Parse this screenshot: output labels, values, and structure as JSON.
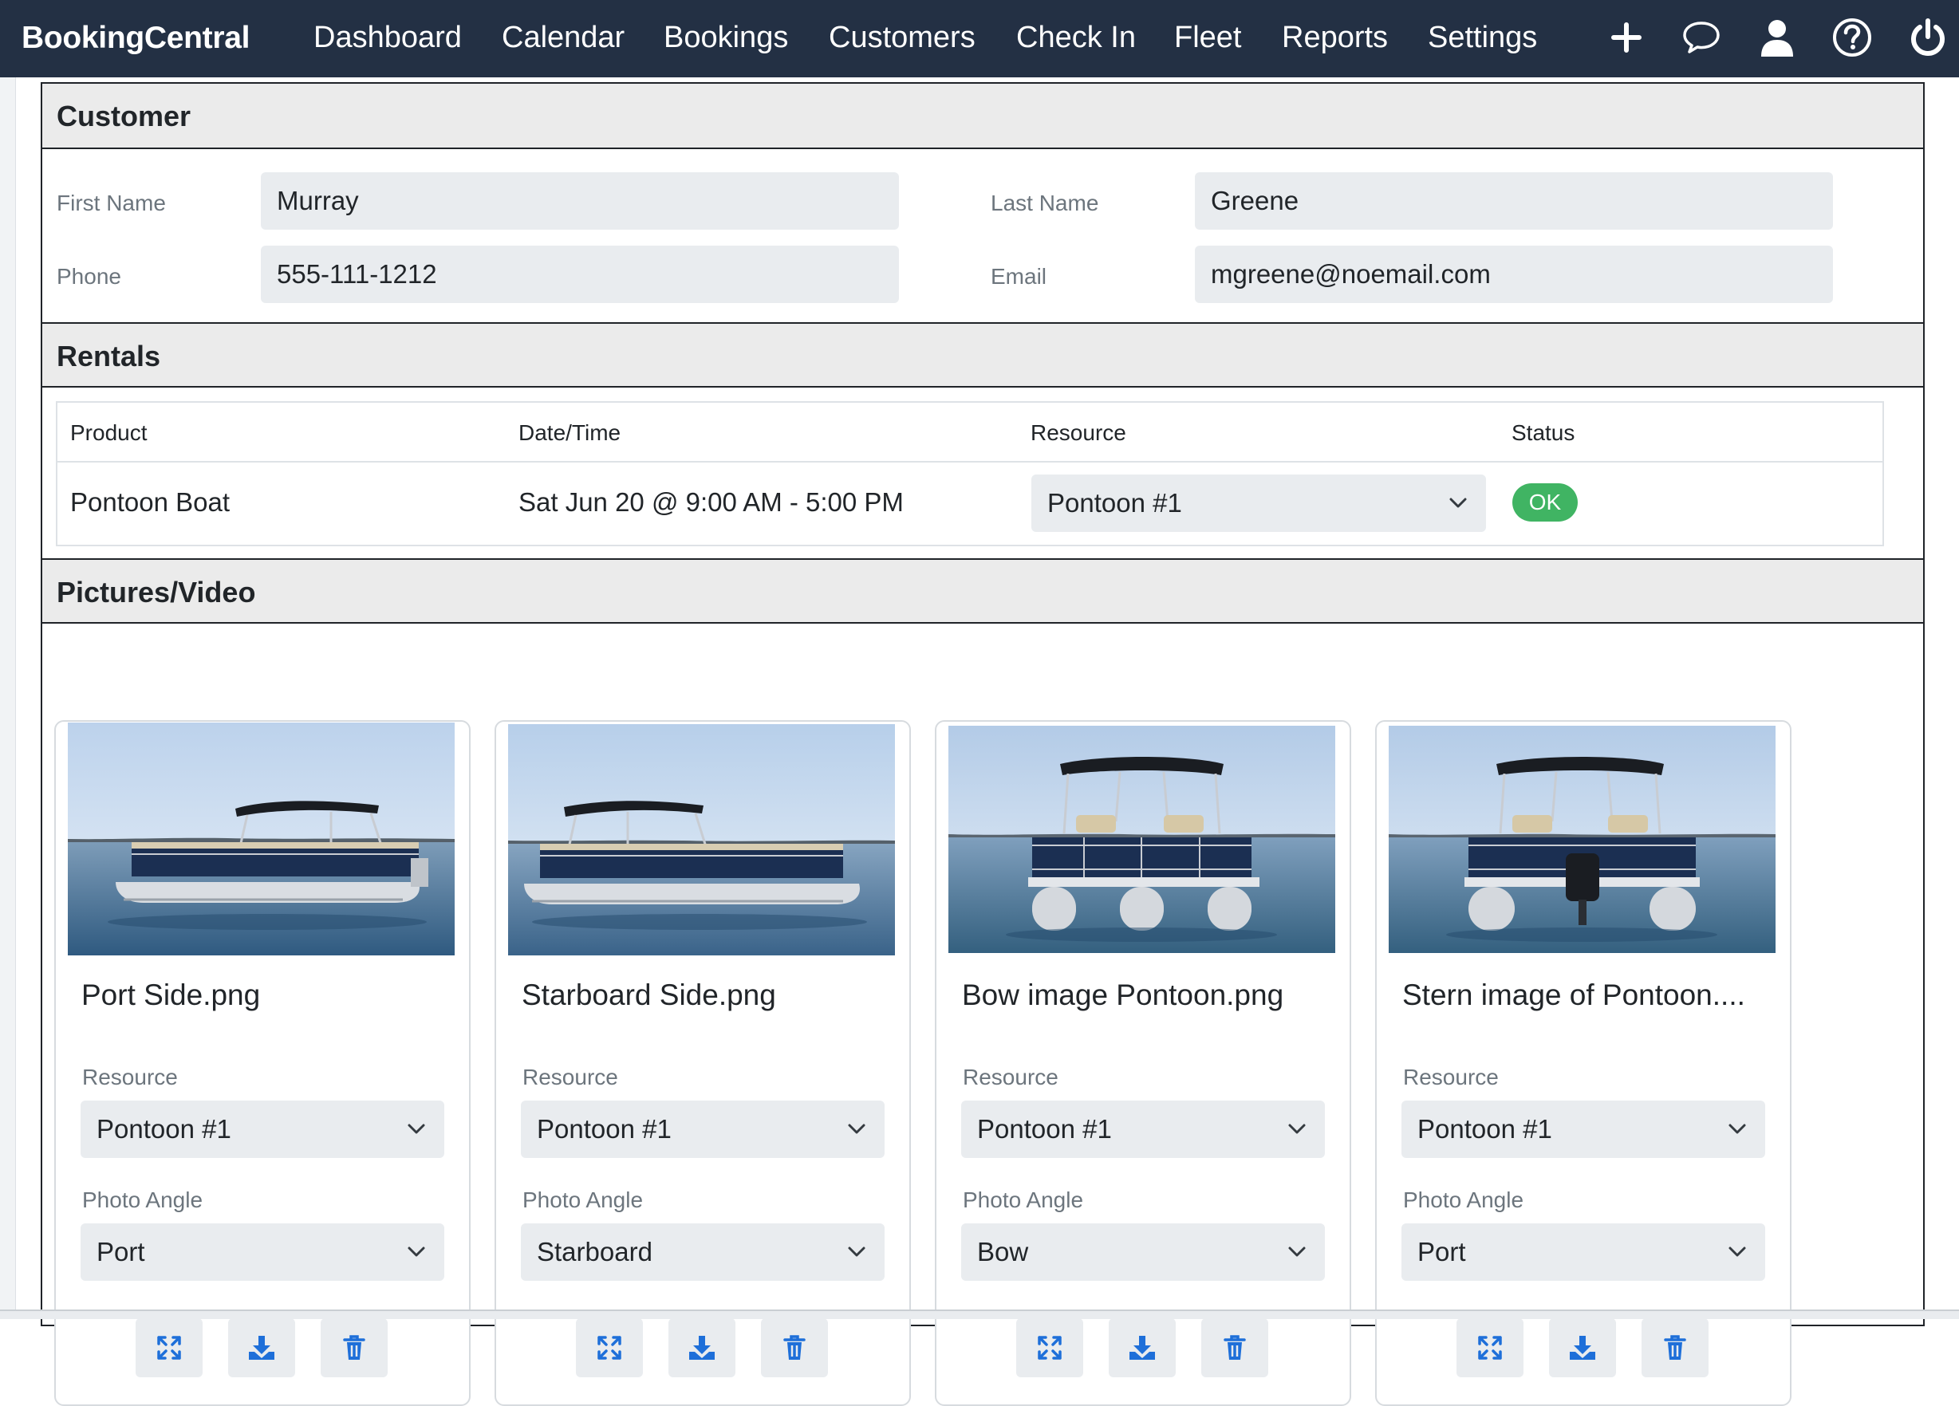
{
  "navbar": {
    "brand": "BookingCentral",
    "links": [
      "Dashboard",
      "Calendar",
      "Bookings",
      "Customers",
      "Check In",
      "Fleet",
      "Reports",
      "Settings"
    ],
    "icons": [
      "plus-icon",
      "chat-bubble-icon",
      "user-icon",
      "help-circle-icon",
      "power-icon"
    ]
  },
  "customer": {
    "heading": "Customer",
    "first_name_label": "First Name",
    "first_name": "Murray",
    "last_name_label": "Last Name",
    "last_name": "Greene",
    "phone_label": "Phone",
    "phone": "555-111-1212",
    "email_label": "Email",
    "email": "mgreene@noemail.com"
  },
  "rentals": {
    "heading": "Rentals",
    "columns": [
      "Product",
      "Date/Time",
      "Resource",
      "Status"
    ],
    "rows": [
      {
        "product": "Pontoon Boat",
        "datetime": "Sat Jun 20 @ 9:00 AM - 5:00 PM",
        "resource": "Pontoon #1",
        "status": "OK"
      }
    ],
    "status_color": "#40b463"
  },
  "media": {
    "heading": "Pictures/Video",
    "resource_label": "Resource",
    "angle_label": "Photo Angle",
    "items": [
      {
        "title": "Port Side.png",
        "resource": "Pontoon #1",
        "angle": "Port"
      },
      {
        "title": "Starboard Side.png",
        "resource": "Pontoon #1",
        "angle": "Starboard"
      },
      {
        "title": "Bow image Pontoon.png",
        "resource": "Pontoon #1",
        "angle": "Bow"
      },
      {
        "title": "Stern image of Pontoon....",
        "resource": "Pontoon #1",
        "angle": "Port"
      }
    ],
    "action_icons": [
      "expand-icon",
      "download-icon",
      "trash-icon"
    ]
  },
  "colors": {
    "navbar_bg": "#233044",
    "accent_blue": "#1e6fd9"
  }
}
